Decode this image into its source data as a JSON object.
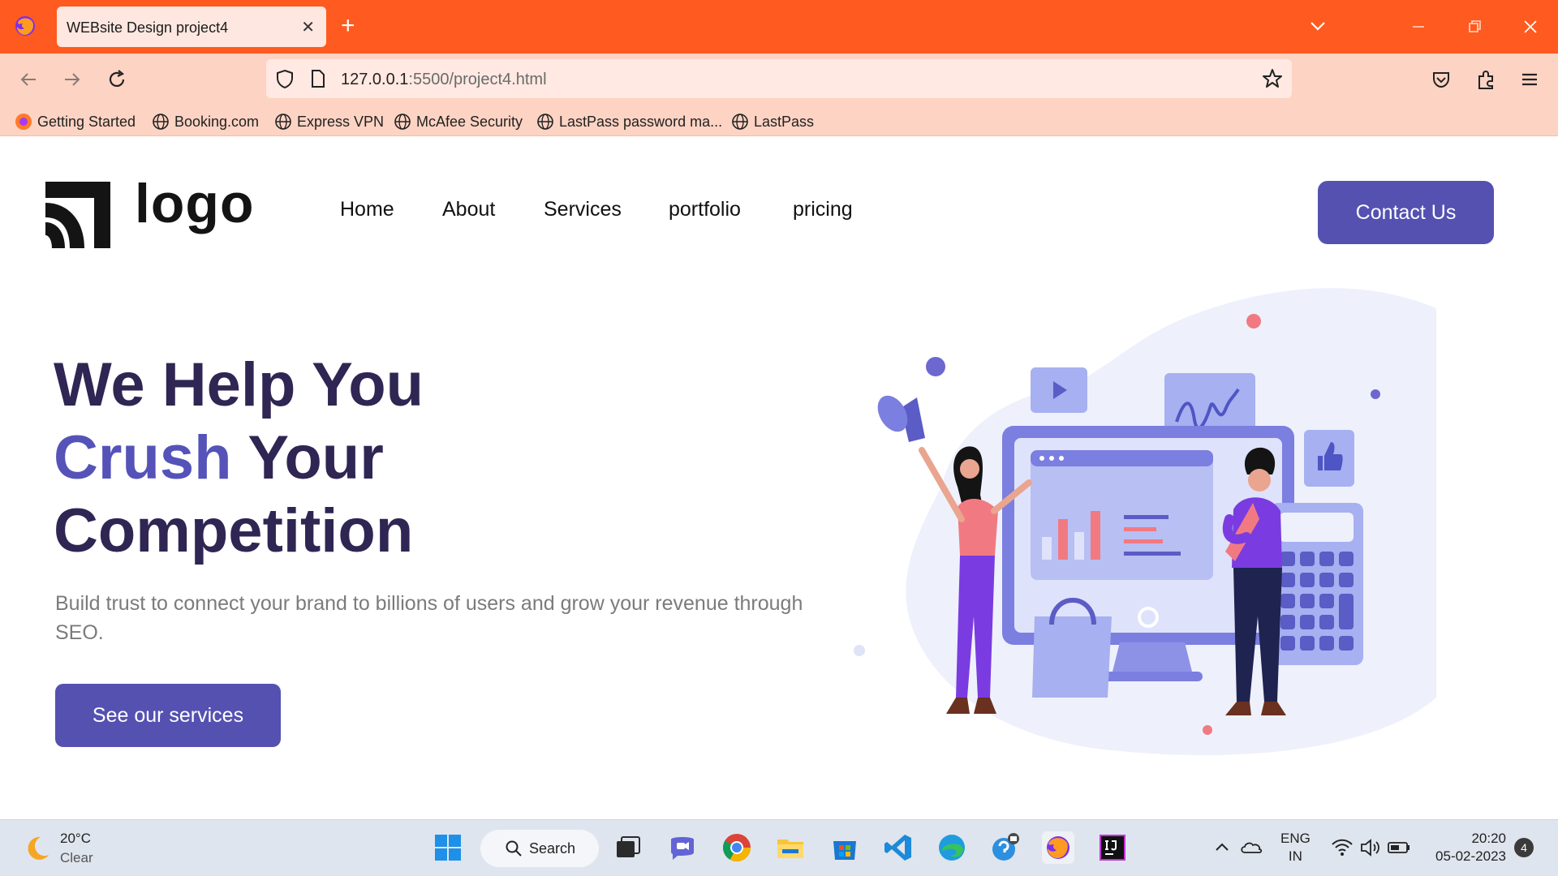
{
  "browser": {
    "tab_title": "WEBsite Design project4",
    "tab_close": "✕",
    "new_tab": "+",
    "url_host": "127.0.0.1",
    "url_path": ":5500/project4.html"
  },
  "bookmarks": [
    {
      "label": "Getting Started",
      "icon": "firefox-icon"
    },
    {
      "label": "Booking.com",
      "icon": "globe-icon"
    },
    {
      "label": "Express VPN",
      "icon": "globe-icon"
    },
    {
      "label": "McAfee Security",
      "icon": "globe-icon"
    },
    {
      "label": "LastPass password ma...",
      "icon": "globe-icon"
    },
    {
      "label": "LastPass",
      "icon": "globe-icon"
    }
  ],
  "site": {
    "logo_text": "logo",
    "nav": [
      "Home",
      "About",
      "Services",
      "portfolio",
      "pricing"
    ],
    "contact_label": "Contact Us",
    "hero": {
      "line1": "We Help You",
      "accent": "Crush",
      "line2_rest": " Your",
      "line3": "Competition",
      "subtitle": "Build trust to connect your brand to billions of users and grow your revenue through SEO.",
      "cta_label": "See our services"
    },
    "colors": {
      "primary": "#5551b1",
      "heading": "#2f2653",
      "accent": "#5553b8"
    }
  },
  "taskbar": {
    "temperature": "20°C",
    "condition": "Clear",
    "search_label": "Search",
    "lang_line1": "ENG",
    "lang_line2": "IN",
    "time": "20:20",
    "date": "05-02-2023",
    "notification_count": "4"
  }
}
